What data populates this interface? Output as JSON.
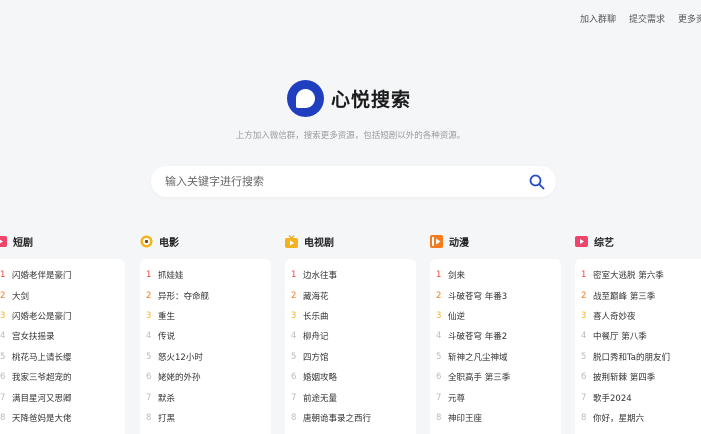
{
  "topnav": [
    "加入群聊",
    "提交需求",
    "更多资"
  ],
  "brand": {
    "name": "心悦搜索"
  },
  "tagline": "上方加入微信群，搜索更多资源，包括短剧以外的各种资源。",
  "search": {
    "placeholder": "输入关键字进行搜索"
  },
  "columns": [
    {
      "title": "短剧",
      "icon": "short-drama-icon",
      "items": [
        "闪婚老伴是豪门",
        "大剑",
        "闪婚老公是豪门",
        "宫女扶摇录",
        "桃花马上请长缨",
        "我家三爷超宠的",
        "满目星河又思卿",
        "天降爸妈是大佬"
      ]
    },
    {
      "title": "电影",
      "icon": "movie-icon",
      "items": [
        "抓娃娃",
        "异形：夺命舰",
        "重生",
        "传说",
        "怒火12小时",
        "姥姥的外孙",
        "默杀",
        "打黑"
      ]
    },
    {
      "title": "电视剧",
      "icon": "tv-icon",
      "items": [
        "边水往事",
        "藏海花",
        "长乐曲",
        "柳舟记",
        "四方馆",
        "婚姻攻略",
        "前途无量",
        "唐朝诡事录之西行"
      ]
    },
    {
      "title": "动漫",
      "icon": "anime-icon",
      "items": [
        "剑来",
        "斗破苍穹 年番3",
        "仙逆",
        "斗破苍穹 年番2",
        "斩神之凡尘神域",
        "全职高手 第三季",
        "元尊",
        "神印王座"
      ]
    },
    {
      "title": "综艺",
      "icon": "variety-icon",
      "items": [
        "密室大逃脱 第六季",
        "战至巅峰 第三季",
        "喜人奇妙夜",
        "中餐厅 第八季",
        "脱口秀和Ta的朋友们",
        "披荆斩棘 第四季",
        "歌手2024",
        "你好，星期六"
      ]
    }
  ]
}
